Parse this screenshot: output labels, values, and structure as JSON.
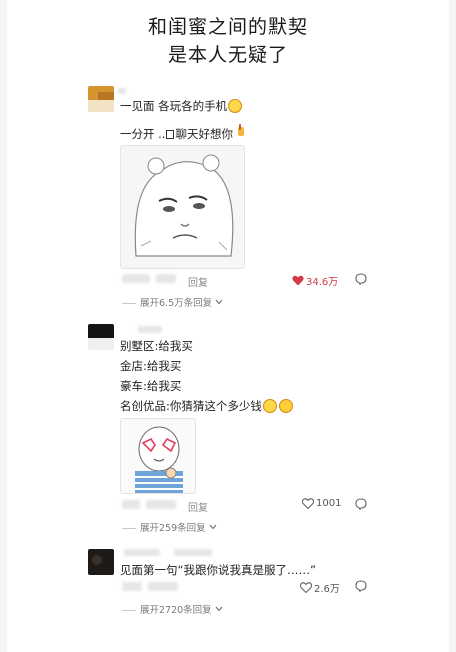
{
  "title": {
    "line1": "和闺蜜之间的默契",
    "line2": "是本人无疑了"
  },
  "comments": [
    {
      "lines": [
        "一见面 各玩各的手机",
        "一分开 ..",
        "聊天好想你"
      ],
      "reply_label": "回复",
      "likes": "34.6万",
      "liked": true,
      "expand": "展开6.5万条回复"
    },
    {
      "lines": [
        "别墅区:给我买",
        "金店:给我买",
        "豪车:给我买",
        "名创优品:你猜猜这个多少钱"
      ],
      "reply_label": "回复",
      "likes": "1001",
      "liked": false,
      "expand": "展开259条回复"
    },
    {
      "lines": [
        "见面第一句“我跟你说我真是服了……”"
      ],
      "likes": "2.6万",
      "liked": false,
      "expand": "展开2720条回复"
    }
  ],
  "icons": {
    "heart": "heart-icon",
    "comment": "comment-bubble-icon",
    "chevron": "chevron-down-icon"
  },
  "colors": {
    "like_red": "#d23a4a",
    "text": "#1f1f1f",
    "muted": "#8a8a8a"
  }
}
